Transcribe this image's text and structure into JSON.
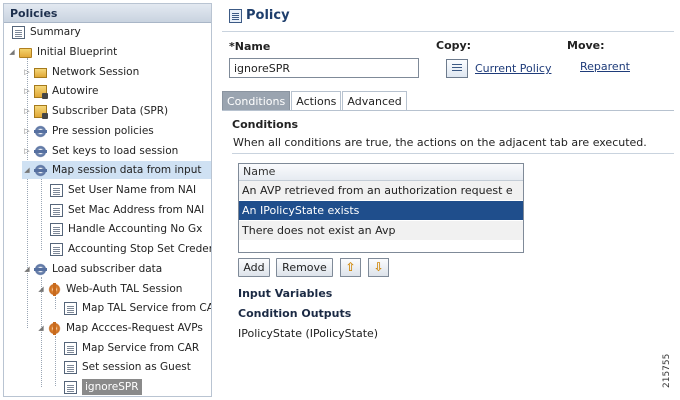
{
  "tree": {
    "header": "Policies",
    "items": [
      {
        "label": "Summary",
        "icon": "document-icon"
      },
      {
        "label": "Initial Blueprint",
        "icon": "folder-open-icon"
      },
      {
        "label": "Network Session",
        "icon": "folder-icon"
      },
      {
        "label": "Autowire",
        "icon": "locked-folder-icon"
      },
      {
        "label": "Subscriber Data (SPR)",
        "icon": "locked-folder-icon"
      },
      {
        "label": "Pre session policies",
        "icon": "gear-icon"
      },
      {
        "label": "Set keys to load session",
        "icon": "gear-icon"
      },
      {
        "label": "Map session data from input",
        "icon": "gear-icon"
      },
      {
        "label": "Set User Name from NAI",
        "icon": "document-icon"
      },
      {
        "label": "Set Mac Address from NAI",
        "icon": "document-icon"
      },
      {
        "label": "Handle Accounting No Gx",
        "icon": "document-icon"
      },
      {
        "label": "Accounting Stop Set Creden",
        "icon": "document-icon"
      },
      {
        "label": "Load subscriber data",
        "icon": "gear-icon"
      },
      {
        "label": "Web-Auth TAL Session",
        "icon": "orange-gear-icon"
      },
      {
        "label": "Map TAL Service from CA",
        "icon": "document-icon"
      },
      {
        "label": "Map Accces-Request AVPs",
        "icon": "orange-gear-icon"
      },
      {
        "label": "Map Service from CAR",
        "icon": "document-icon"
      },
      {
        "label": "Set session as Guest",
        "icon": "document-icon"
      },
      {
        "label": "ignoreSPR",
        "icon": "document-icon"
      }
    ]
  },
  "policy": {
    "title": "Policy",
    "name_label": "*Name",
    "name_value": "ignoreSPR",
    "copy_label": "Copy:",
    "copy_link": "Current Policy",
    "move_label": "Move:",
    "move_link": "Reparent"
  },
  "tabs": [
    "Conditions",
    "Actions",
    "Advanced"
  ],
  "conditions": {
    "title": "Conditions",
    "description": "When all conditions are true, the actions on the adjacent tab are executed.",
    "list_header": "Name",
    "rows": [
      "An AVP retrieved from an authorization request e",
      "An IPolicyState exists",
      "There does not exist an Avp"
    ],
    "add_button": "Add",
    "remove_button": "Remove"
  },
  "input_variables_title": "Input Variables",
  "condition_outputs_title": "Condition Outputs",
  "condition_output_value": "IPolicyState (IPolicyState)",
  "figure_number": "215755",
  "colors": {
    "selection": "#1f4e8c",
    "tree_highlight": "#cfe1f3",
    "title_blue": "#1e3e6c",
    "arrow_orange": "#d08a10"
  }
}
